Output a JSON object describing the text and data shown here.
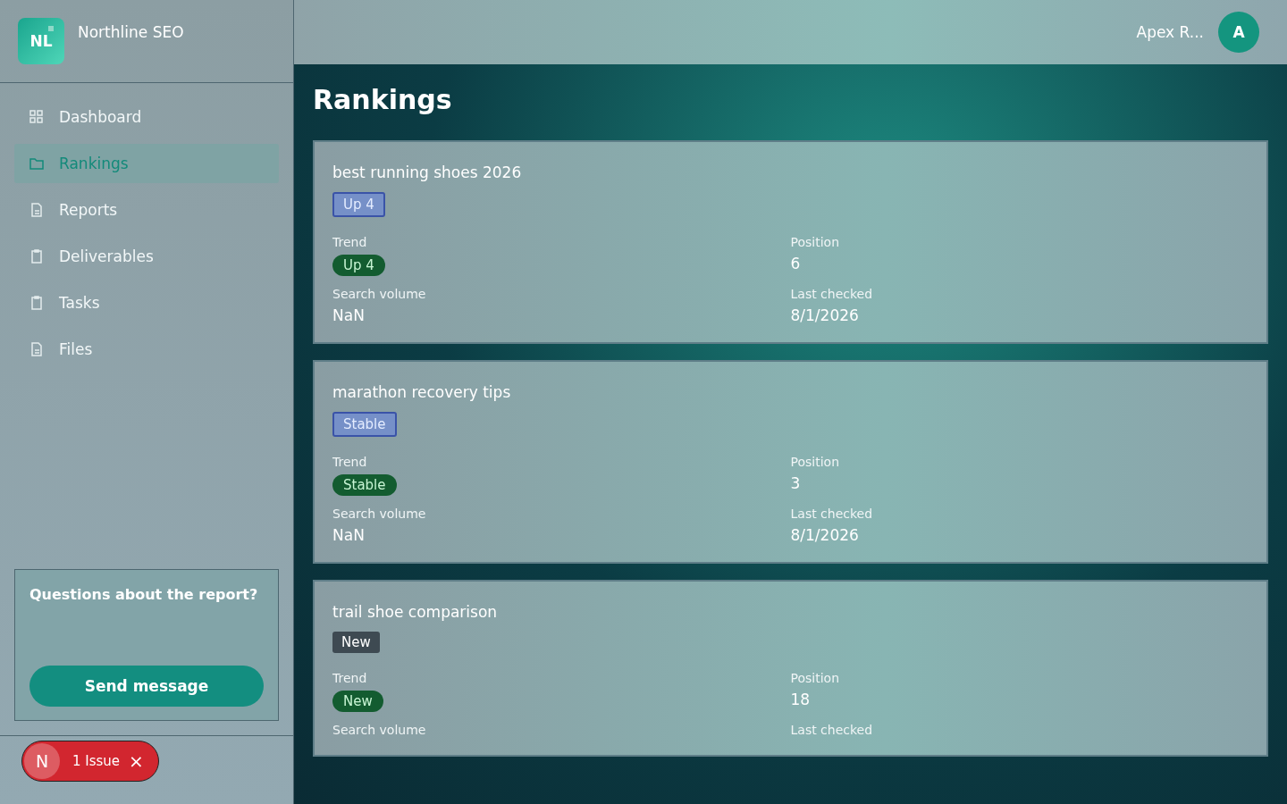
{
  "brand": {
    "logo": "NL",
    "name": "Northline SEO"
  },
  "nav": [
    {
      "label": "Dashboard",
      "selected": false
    },
    {
      "label": "Rankings",
      "selected": true
    },
    {
      "label": "Reports",
      "selected": false
    },
    {
      "label": "Deliverables",
      "selected": false
    },
    {
      "label": "Tasks",
      "selected": false
    },
    {
      "label": "Files",
      "selected": false
    }
  ],
  "help_card": {
    "title": "Questions about the report?",
    "button": "Send message"
  },
  "issue_badge": {
    "letter": "N",
    "label": "1 Issue",
    "close": "×"
  },
  "user": {
    "name": "Apex R...",
    "avatar": "A"
  },
  "page_title": "Rankings",
  "keywords": [
    {
      "keyword": "best running shoes 2026",
      "badge": {
        "kind": "up",
        "label": "Up 4"
      },
      "fields": [
        {
          "label": "Trend",
          "value": "Up 4",
          "kind": "pill"
        },
        {
          "label": "Position",
          "value": "6",
          "kind": "text"
        },
        {
          "label": "Search volume",
          "value": "NaN",
          "kind": "text"
        },
        {
          "label": "Last checked",
          "value": "8/1/2026",
          "kind": "text"
        }
      ]
    },
    {
      "keyword": "marathon recovery tips",
      "badge": {
        "kind": "stable",
        "label": "Stable"
      },
      "fields": [
        {
          "label": "Trend",
          "value": "Stable",
          "kind": "pill"
        },
        {
          "label": "Position",
          "value": "3",
          "kind": "text"
        },
        {
          "label": "Search volume",
          "value": "NaN",
          "kind": "text"
        },
        {
          "label": "Last checked",
          "value": "8/1/2026",
          "kind": "text"
        }
      ]
    },
    {
      "keyword": "trail shoe comparison",
      "badge": {
        "kind": "new",
        "label": "New"
      },
      "fields": [
        {
          "label": "Trend",
          "value": "New",
          "kind": "pill"
        },
        {
          "label": "Position",
          "value": "18",
          "kind": "text"
        },
        {
          "label": "Search volume"
        },
        {
          "label": "Last checked"
        }
      ]
    }
  ]
}
